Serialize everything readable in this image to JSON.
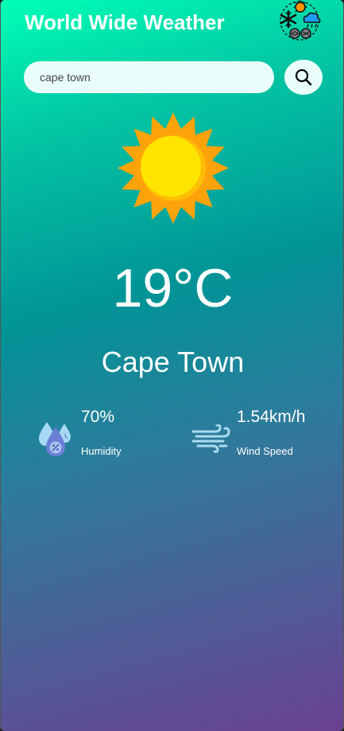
{
  "header": {
    "title": "World Wide Weather",
    "logo_icon": "weather-collage-icon"
  },
  "search": {
    "value": "cape town",
    "placeholder": "",
    "button_icon": "search-icon"
  },
  "weather": {
    "condition_icon": "sun-icon",
    "temperature": "19°C",
    "city": "Cape Town"
  },
  "details": {
    "humidity": {
      "value": "70%",
      "label": "Humidity",
      "icon": "humidity-icon"
    },
    "wind": {
      "value": "1.54km/h",
      "label": "Wind Speed",
      "icon": "wind-icon"
    }
  },
  "colors": {
    "gradient_top": "#00ffb6",
    "gradient_middle": "#019497",
    "gradient_bottom": "#6a4192",
    "input_background": "#e9fefa",
    "sun_ray": "#ffa30a",
    "sun_core": "#ffe400"
  }
}
